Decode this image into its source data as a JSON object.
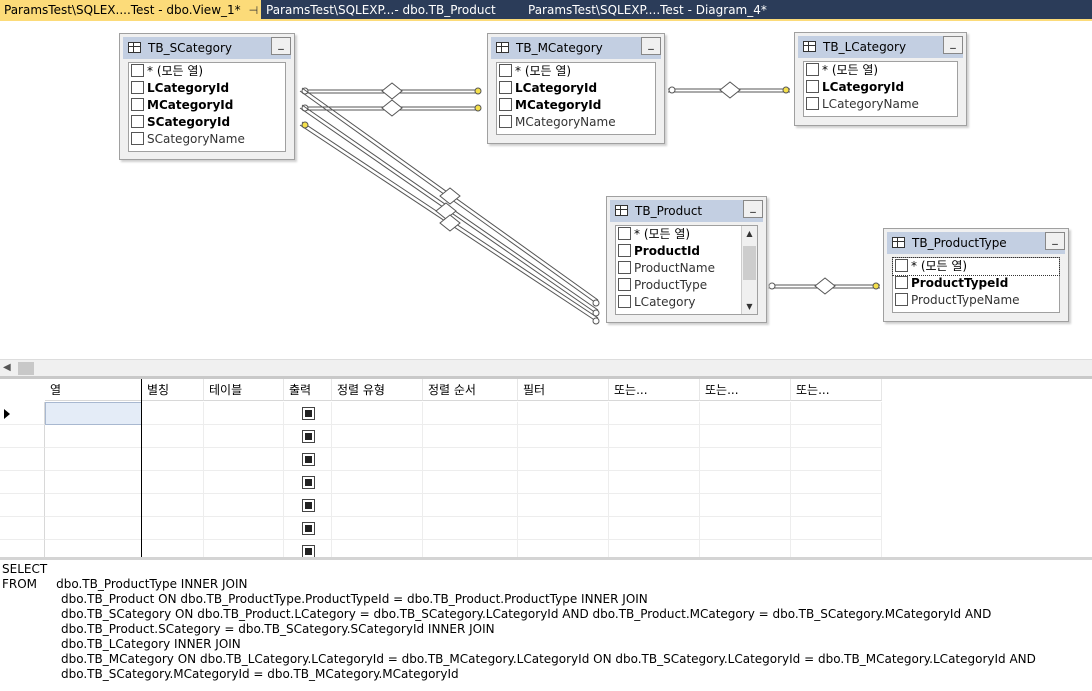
{
  "tabs": [
    {
      "label": "ParamsTest\\SQLEX....Test - dbo.View_1*",
      "active": true,
      "pin": "⊣",
      "close": "×"
    },
    {
      "label": "ParamsTest\\SQLEXP...- dbo.TB_Product",
      "active": false
    },
    {
      "label": "ParamsTest\\SQLEXP....Test - Diagram_4*",
      "active": false
    }
  ],
  "tables": {
    "scategory": {
      "title": "TB_SCategory",
      "columns": [
        {
          "label": "* (모든 열)",
          "key": false
        },
        {
          "label": "LCategoryId",
          "key": true
        },
        {
          "label": "MCategoryId",
          "key": true
        },
        {
          "label": "SCategoryId",
          "key": true
        },
        {
          "label": "SCategoryName",
          "key": false
        }
      ]
    },
    "mcategory": {
      "title": "TB_MCategory",
      "columns": [
        {
          "label": "* (모든 열)",
          "key": false
        },
        {
          "label": "LCategoryId",
          "key": true
        },
        {
          "label": "MCategoryId",
          "key": true
        },
        {
          "label": "MCategoryName",
          "key": false
        }
      ]
    },
    "lcategory": {
      "title": "TB_LCategory",
      "columns": [
        {
          "label": "* (모든 열)",
          "key": false
        },
        {
          "label": "LCategoryId",
          "key": true
        },
        {
          "label": "LCategoryName",
          "key": false
        }
      ]
    },
    "product": {
      "title": "TB_Product",
      "columns": [
        {
          "label": "* (모든 열)",
          "key": false
        },
        {
          "label": "ProductId",
          "key": true
        },
        {
          "label": "ProductName",
          "key": false
        },
        {
          "label": "ProductType",
          "key": false
        },
        {
          "label": "LCategory",
          "key": false
        }
      ]
    },
    "producttype": {
      "title": "TB_ProductType",
      "columns": [
        {
          "label": "* (모든 열)",
          "key": false
        },
        {
          "label": "ProductTypeId",
          "key": true
        },
        {
          "label": "ProductTypeName",
          "key": false
        }
      ]
    }
  },
  "grid": {
    "headers": [
      "열",
      "별칭",
      "테이블",
      "출력",
      "정렬 유형",
      "정렬 순서",
      "필터",
      "또는...",
      "또는...",
      "또는..."
    ]
  },
  "sql": {
    "lines": [
      "SELECT",
      "FROM     dbo.TB_ProductType INNER JOIN",
      "dbo.TB_Product ON dbo.TB_ProductType.ProductTypeId = dbo.TB_Product.ProductType INNER JOIN",
      "dbo.TB_SCategory ON dbo.TB_Product.LCategory = dbo.TB_SCategory.LCategoryId AND dbo.TB_Product.MCategory = dbo.TB_SCategory.MCategoryId AND",
      "dbo.TB_Product.SCategory = dbo.TB_SCategory.SCategoryId INNER JOIN",
      "dbo.TB_LCategory INNER JOIN",
      "dbo.TB_MCategory ON dbo.TB_LCategory.LCategoryId = dbo.TB_MCategory.LCategoryId ON dbo.TB_SCategory.LCategoryId = dbo.TB_MCategory.LCategoryId AND",
      "dbo.TB_SCategory.MCategoryId = dbo.TB_MCategory.MCategoryId"
    ]
  },
  "colors": {
    "tabstrip_bg": "#2b3c59",
    "active_tab": "#fcdb79",
    "table_title": "#c3cfe2",
    "key_end": "#f5e04a"
  }
}
